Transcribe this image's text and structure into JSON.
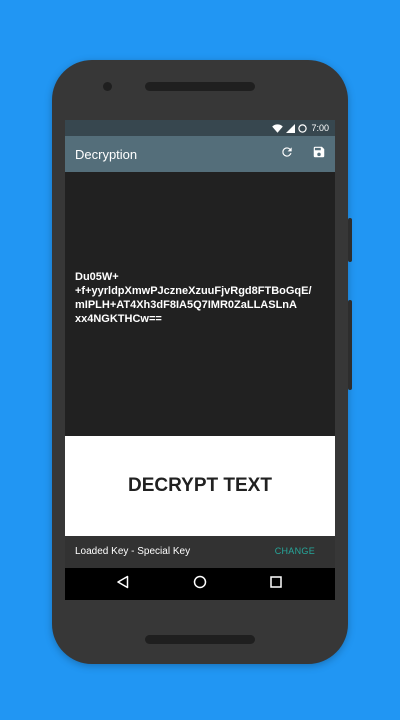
{
  "colors": {
    "background": "#2196F3",
    "status_bar": "#37474F",
    "app_bar": "#546E7A",
    "content_bg": "#212121",
    "snackbar_action": "#26A69A"
  },
  "status_bar": {
    "time": "7:00",
    "icons": [
      "wifi-icon",
      "signal-icon",
      "battery-icon"
    ]
  },
  "app_bar": {
    "title": "Decryption",
    "actions": [
      "refresh-icon",
      "save-icon"
    ]
  },
  "content": {
    "cipher_text": "Du05W+\n+f+yyrldpXmwPJczneXzuuFjvRgd8FTBoGqE/\nmIPLH+AT4Xh3dF8IA5Q7IMR0ZaLLASLnA\nxx4NGKTHCw=="
  },
  "decrypt_button": {
    "label": "DECRYPT TEXT"
  },
  "snackbar": {
    "message": "Loaded Key - Special Key",
    "action": "CHANGE"
  },
  "nav_bar": {
    "buttons": [
      "back-icon",
      "home-icon",
      "recents-icon"
    ]
  }
}
